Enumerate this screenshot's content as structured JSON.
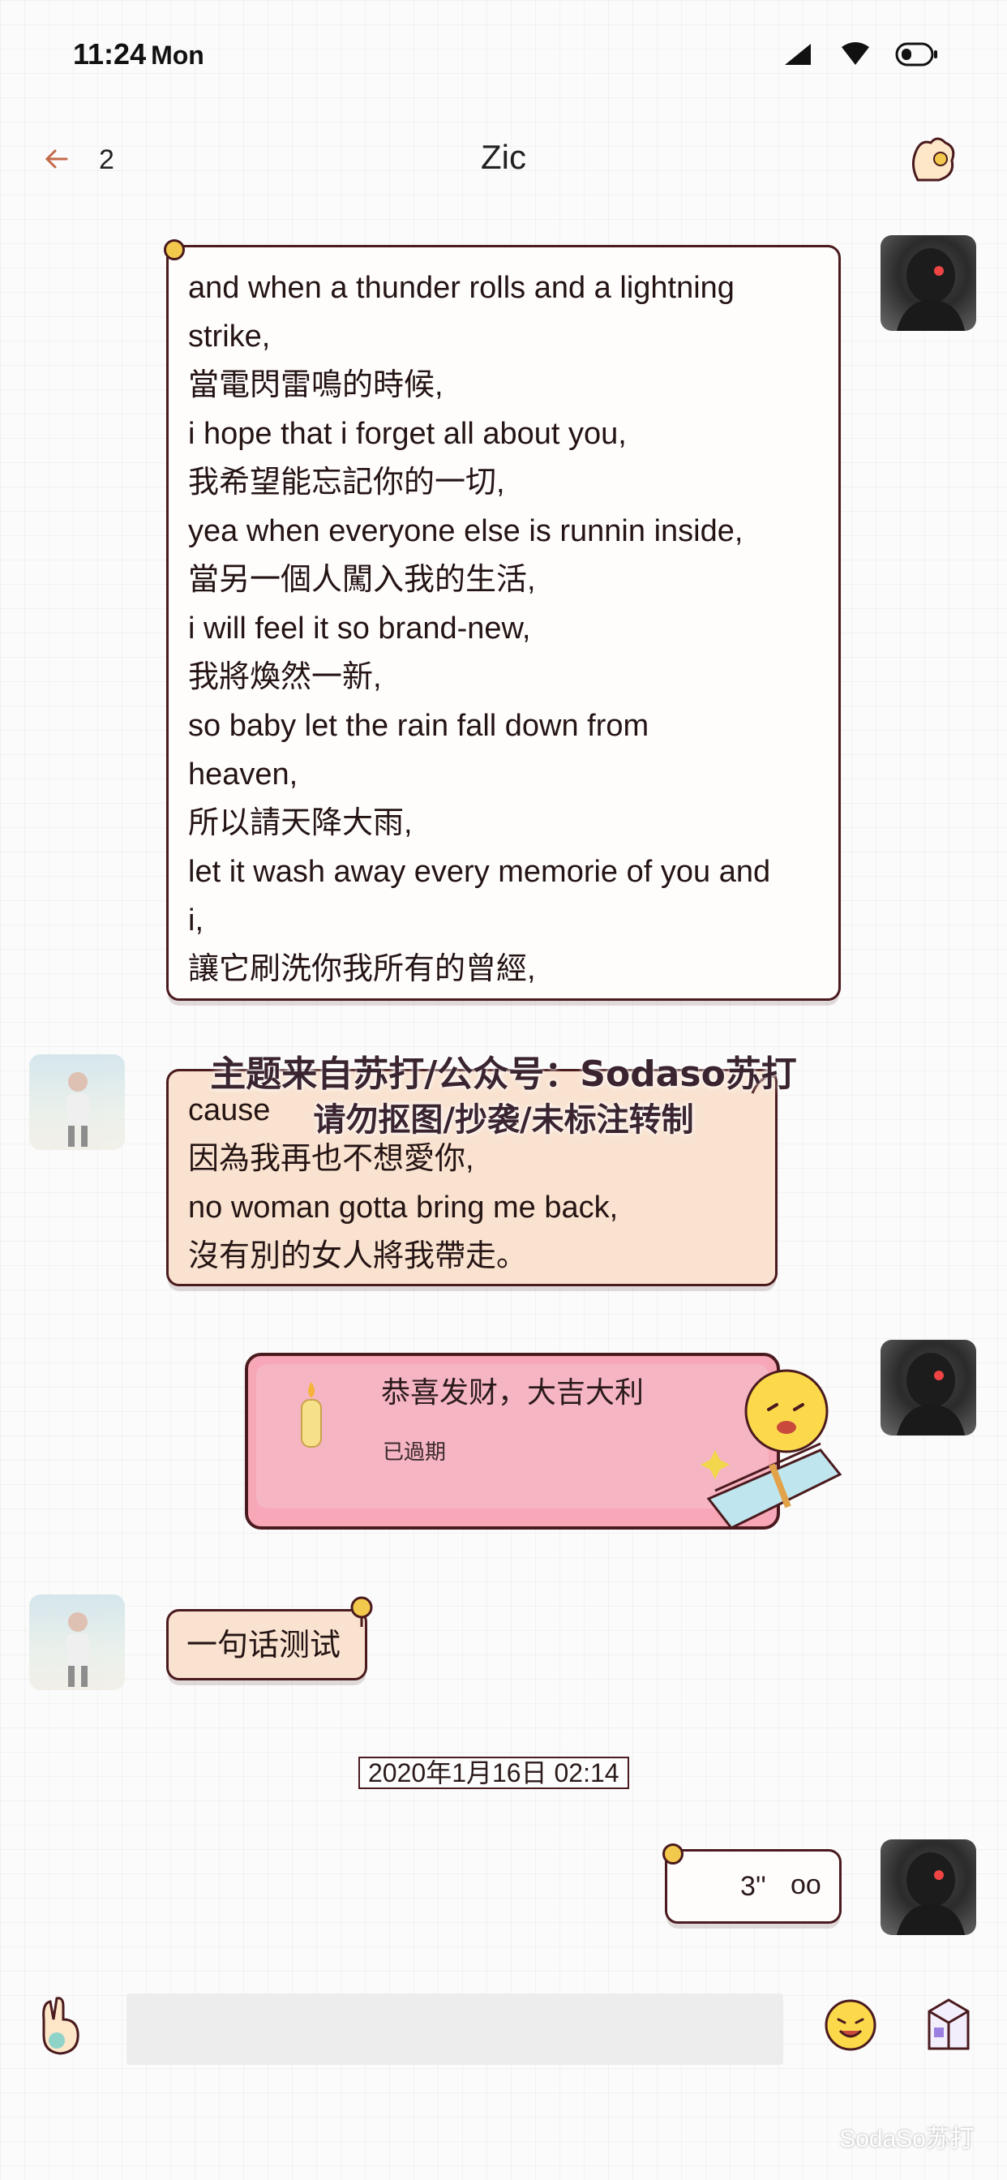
{
  "status_bar": {
    "time": "11:24",
    "day": "Mon"
  },
  "header": {
    "unread_count": "2",
    "title": "Zic"
  },
  "messages": {
    "lyrics_out": {
      "lines": [
        "and when a thunder rolls and a lightning",
        "strike,",
        "當電閃雷鳴的時候,",
        "i hope that i forget all about you,",
        "我希望能忘記你的一切,",
        "yea when everyone else is runnin inside,",
        "當另一個人闖入我的生活,",
        "i will feel it so brand-new,",
        "我將煥然一新,",
        "so baby let the rain fall down from",
        "heaven,",
        "所以請天降大雨,",
        "let it wash away every memorie of you and",
        "i,",
        "讓它刷洗你我所有的曾經,"
      ]
    },
    "lyrics_in": {
      "lines": [
        "cause",
        "因為我再也不想愛你,",
        "no woman gotta bring me back,",
        "沒有別的女人將我帶走。"
      ]
    },
    "red_packet": {
      "title": "恭喜发财，大吉大利",
      "status": "已過期"
    },
    "short_in": {
      "text": "一句话测试"
    },
    "timestamp": "2020年1月16日 02:14",
    "voice_out": {
      "duration": "3''",
      "wave": "oo"
    }
  },
  "watermark": {
    "line1": "主题来自苏打/公众号：Sodaso苏打",
    "line2": "请勿抠图/抄袭/未标注转制"
  },
  "footer": {
    "brand": "SodaSo苏打"
  },
  "colors": {
    "border": "#4a1a1e",
    "peach_bubble": "#f9e2cf",
    "red_packet": "#f7a7b7",
    "pin": "#f2c94c"
  }
}
